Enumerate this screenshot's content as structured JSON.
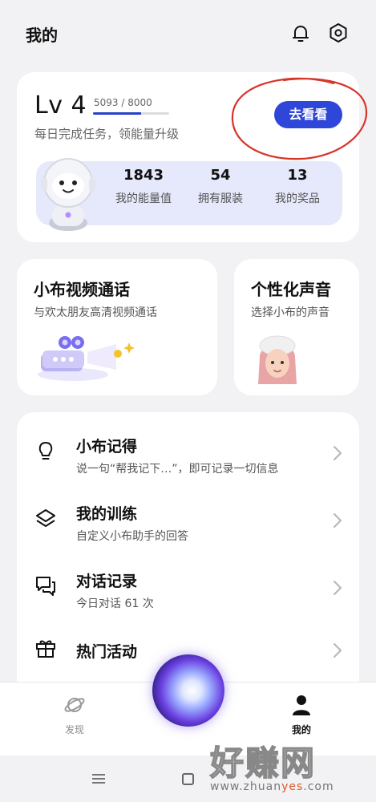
{
  "header": {
    "title": "我的"
  },
  "level_card": {
    "level": "Lv 4",
    "progress_text": "5093 / 8000",
    "progress_fraction": 0.6366,
    "subtitle": "每日完成任务，领能量升级",
    "button_label": "去看看",
    "stats": [
      {
        "value": "1843",
        "label": "我的能量值"
      },
      {
        "value": "54",
        "label": "拥有服装"
      },
      {
        "value": "13",
        "label": "我的奖品"
      }
    ]
  },
  "video_call_card": {
    "title": "小布视频通话",
    "subtitle": "与欢太朋友高清视频通话"
  },
  "voice_card": {
    "title": "个性化声音",
    "subtitle": "选择小布的声音"
  },
  "list": [
    {
      "title": "小布记得",
      "subtitle": "说一句“帮我记下…”，即可记录一切信息",
      "icon": "lightbulb-icon"
    },
    {
      "title": "我的训练",
      "subtitle": "自定义小布助手的回答",
      "icon": "layers-icon"
    },
    {
      "title": "对话记录",
      "subtitle": "今日对话 61 次",
      "icon": "chat-icon"
    },
    {
      "title": "热门活动",
      "subtitle": "",
      "icon": "gift-icon"
    }
  ],
  "bottom_nav": {
    "discover_label": "发现",
    "mine_label": "我的"
  },
  "watermark": {
    "big": "好赚网",
    "small_prefix": "www.zhuan",
    "small_highlight": "yes",
    "small_suffix": ".com"
  },
  "colors": {
    "accent": "#2f47d8",
    "annotation": "#d9342b",
    "stats_bg": "#e6e8fb"
  }
}
